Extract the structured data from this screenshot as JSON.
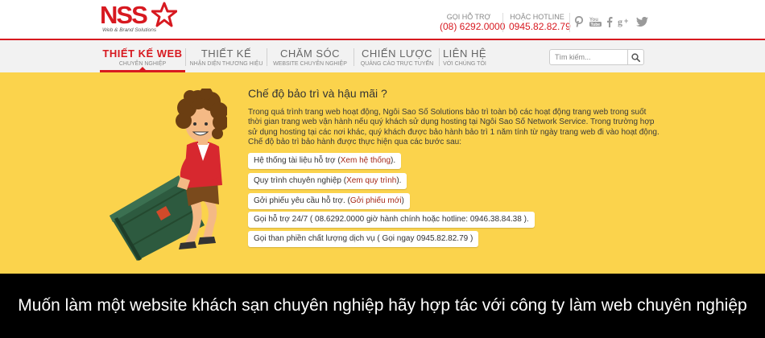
{
  "header": {
    "logo_text": "NSS",
    "logo_subtitle": "Web & Brand Solutions",
    "support": {
      "label": "GỌI HỖ TRỢ",
      "number": "(08) 6292.0000"
    },
    "hotline": {
      "label": "HOẶC HOTLINE",
      "number": "0945.82.82.79"
    },
    "social": [
      {
        "icon": "pinterest-icon",
        "glyph": "P"
      },
      {
        "icon": "youtube-icon",
        "glyph": "You"
      },
      {
        "icon": "facebook-icon",
        "glyph": "f"
      },
      {
        "icon": "google-plus-icon",
        "glyph": "g+"
      },
      {
        "icon": "twitter-icon",
        "glyph": "t"
      }
    ]
  },
  "nav": {
    "items": [
      {
        "title": "THIẾT KẾ WEB",
        "sub": "CHUYÊN NGHIỆP",
        "active": true
      },
      {
        "title": "THIẾT KẾ",
        "sub": "NHẬN DIỆN THƯƠNG HIỆU",
        "active": false
      },
      {
        "title": "CHĂM SÓC",
        "sub": "WEBSITE CHUYÊN NGHIỆP",
        "active": false
      },
      {
        "title": "CHIẾN LƯỢC",
        "sub": "QUẢNG CÁO TRỰC TUYẾN",
        "active": false
      },
      {
        "title": "LIÊN HỆ",
        "sub": "VỚI CHÚNG TÔI",
        "active": false
      }
    ],
    "search_placeholder": "Tìm kiếm..."
  },
  "main": {
    "title": "Chế độ bảo trì và hậu mãi ?",
    "description_lines": [
      "Trong quá trình trang web hoạt động, Ngôi Sao Số Solutions bảo trì toàn bộ các hoạt động trang web trong suốt",
      "thời gian trang web vận hành nếu quý khách sử dụng hosting tại Ngôi Sao Số Network Service. Trong trường hợp",
      "sử dụng hosting tại các nơi khác, quý khách được bảo hành bảo trì 1 năm tính từ ngày trang web đi vào hoạt động.",
      "Chế độ bảo trì bảo hành được thực hiện qua các bước sau:"
    ],
    "steps": [
      {
        "text": "Hệ thống tài liệu hỗ trợ (",
        "link": "Xem hệ thống",
        "after": ")."
      },
      {
        "text": "Quy trình chuyên nghiệp (",
        "link": "Xem quy trình",
        "after": ")."
      },
      {
        "text": "Gởi phiếu yêu cầu hỗ trợ. (",
        "link": "Gởi phiếu mới",
        "after": ")"
      },
      {
        "text": "Gọi hỗ trợ 24/7 ( 08.6292.0000 giờ hành chính hoặc hotline: 0946.38.84.38 ).",
        "link": "",
        "after": ""
      },
      {
        "text": "Gọi than phiền chất lượng dịch vụ ( Gọi ngay 0945.82.82.79 )",
        "link": "",
        "after": ""
      }
    ]
  },
  "caption": {
    "text": "Muốn làm một website khách sạn chuyên nghiệp hãy hợp tác với công ty làm web chuyên nghiệp"
  },
  "colors": {
    "brand_red": "#d71920",
    "main_yellow": "#fbd34c",
    "caption_bg": "#000000",
    "link": "#a52a1a"
  }
}
